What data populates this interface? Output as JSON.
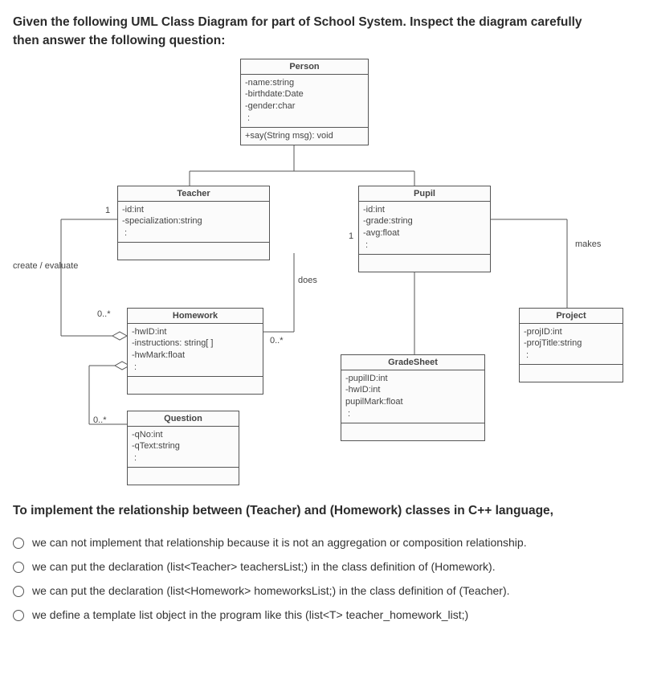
{
  "prompt_line1": "Given the following UML Class Diagram for part of School System. Inspect the diagram carefully",
  "prompt_line2": "then answer the following question:",
  "uml": {
    "person": {
      "title": "Person",
      "attrs": "-name:string\n-birthdate:Date\n-gender:char\n :",
      "ops": "+say(String msg): void"
    },
    "teacher": {
      "title": "Teacher",
      "attrs": "-id:int\n-specialization:string\n :",
      "ops": " "
    },
    "pupil": {
      "title": "Pupil",
      "attrs": "-id:int\n-grade:string\n-avg:float\n :",
      "ops": " "
    },
    "homework": {
      "title": "Homework",
      "attrs": "-hwID:int\n-instructions: string[ ]\n-hwMark:float\n :",
      "ops": " "
    },
    "question": {
      "title": "Question",
      "attrs": "-qNo:int\n-qText:string\n :",
      "ops": " "
    },
    "gradesheet": {
      "title": "GradeSheet",
      "attrs": "-pupilID:int\n-hwID:int\npupilMark:float\n :",
      "ops": " "
    },
    "project": {
      "title": "Project",
      "attrs": "-projID:int\n-projTitle:string\n :",
      "ops": " "
    }
  },
  "labels": {
    "create_eval": "create / evaluate",
    "does": "does",
    "makes": "makes",
    "one_a": "1",
    "one_b": "1",
    "zero_star_a": "0..*",
    "zero_star_b": "0..*",
    "zero_star_c": "0..*"
  },
  "question_stem": "To implement the relationship between (Teacher) and (Homework) classes in C++ language,",
  "options": {
    "a": "we can not implement that relationship because it is not an aggregation or composition relationship.",
    "b": "we can put the declaration (list<Teacher> teachersList;) in the class definition of (Homework).",
    "c": "we can put the declaration (list<Homework> homeworksList;) in the class definition of (Teacher).",
    "d": "we define a template list object in the program like this (list<T> teacher_homework_list;)"
  }
}
